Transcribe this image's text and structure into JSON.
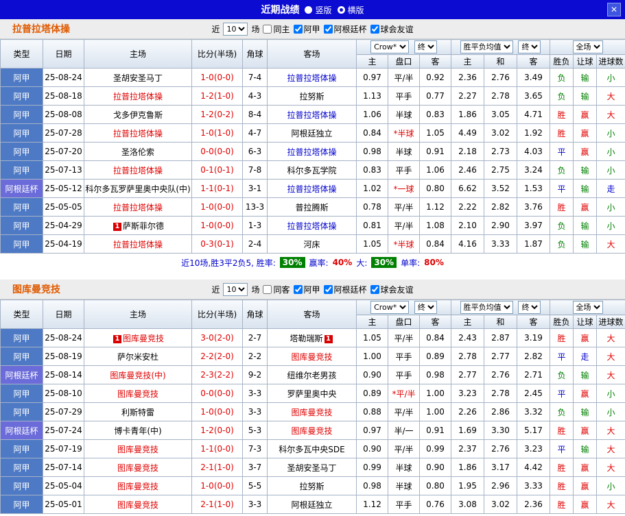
{
  "titlebar": {
    "title": "近期战绩",
    "radio_vertical": "竖版",
    "radio_horizontal": "横版",
    "selected_layout": "横版",
    "close": "✕"
  },
  "colors": {
    "titlebar_bg": "#0b0bd2",
    "section_title": "#e05a00",
    "league_bg": {
      "阿甲": "#4d79c5",
      "阿根廷杯": "#6b6bd9"
    },
    "team": {
      "red": "#e00000",
      "blue": "#0000cc",
      "black": "#000000"
    },
    "score": "#e00000",
    "handicap_star": "#e00000",
    "result_char": {
      "胜": "#e00000",
      "赢": "#e00000",
      "大": "#e00000",
      "平": "#0000cc",
      "走": "#0000cc",
      "负": "#008000",
      "输": "#008000",
      "小": "#008000"
    },
    "summary_badge": "#008000"
  },
  "table_head": {
    "type": "类型",
    "date": "日期",
    "home": "主场",
    "score": "比分(半场)",
    "corner": "角球",
    "away": "客场",
    "odds_select": "Crow*",
    "final_select": "终",
    "odds_sub": [
      "主",
      "盘口",
      "客"
    ],
    "avg_select": "胜平负均值",
    "avg_sub": [
      "主",
      "和",
      "客"
    ],
    "fulltime_select": "全场",
    "result_sub": [
      "胜负",
      "让球",
      "进球数"
    ]
  },
  "sections": [
    {
      "team": "拉普拉塔体操",
      "filters": {
        "near": "近",
        "count": "10",
        "games": "场",
        "checkboxes": [
          {
            "label": "同主",
            "checked": false
          },
          {
            "label": "阿甲",
            "checked": true
          },
          {
            "label": "阿根廷杯",
            "checked": true
          },
          {
            "label": "球会友谊",
            "checked": true
          }
        ]
      },
      "rows": [
        {
          "league": "阿甲",
          "date": "25-08-24",
          "home": "圣胡安圣马丁",
          "home_color": "black",
          "score": "1-0(0-0)",
          "corner": "7-4",
          "away": "拉普拉塔体操",
          "away_color": "blue",
          "w_home": "0.97",
          "handicap": "平/半",
          "w_away": "0.92",
          "avg_home": "2.36",
          "avg_draw": "2.76",
          "avg_away": "3.49",
          "res": [
            "负",
            "输",
            "小"
          ]
        },
        {
          "league": "阿甲",
          "date": "25-08-18",
          "home": "拉普拉塔体操",
          "home_color": "red",
          "score": "1-2(1-0)",
          "corner": "4-3",
          "away": "拉努斯",
          "away_color": "black",
          "w_home": "1.13",
          "handicap": "平手",
          "w_away": "0.77",
          "avg_home": "2.27",
          "avg_draw": "2.78",
          "avg_away": "3.65",
          "res": [
            "负",
            "输",
            "大"
          ]
        },
        {
          "league": "阿甲",
          "date": "25-08-08",
          "home": "戈多伊克鲁斯",
          "home_color": "black",
          "score": "1-2(0-2)",
          "corner": "8-4",
          "away": "拉普拉塔体操",
          "away_color": "blue",
          "w_home": "1.06",
          "handicap": "半球",
          "w_away": "0.83",
          "avg_home": "1.86",
          "avg_draw": "3.05",
          "avg_away": "4.71",
          "res": [
            "胜",
            "赢",
            "大"
          ]
        },
        {
          "league": "阿甲",
          "date": "25-07-28",
          "home": "拉普拉塔体操",
          "home_color": "red",
          "score": "1-0(1-0)",
          "corner": "4-7",
          "away": "阿根廷独立",
          "away_color": "black",
          "w_home": "0.84",
          "handicap": "*半球",
          "w_away": "1.05",
          "avg_home": "4.49",
          "avg_draw": "3.02",
          "avg_away": "1.92",
          "res": [
            "胜",
            "赢",
            "小"
          ]
        },
        {
          "league": "阿甲",
          "date": "25-07-20",
          "home": "圣洛伦索",
          "home_color": "black",
          "score": "0-0(0-0)",
          "corner": "6-3",
          "away": "拉普拉塔体操",
          "away_color": "blue",
          "w_home": "0.98",
          "handicap": "半球",
          "w_away": "0.91",
          "avg_home": "2.18",
          "avg_draw": "2.73",
          "avg_away": "4.03",
          "res": [
            "平",
            "赢",
            "小"
          ]
        },
        {
          "league": "阿甲",
          "date": "25-07-13",
          "home": "拉普拉塔体操",
          "home_color": "red",
          "score": "0-1(0-1)",
          "corner": "7-8",
          "away": "科尔多瓦学院",
          "away_color": "black",
          "w_home": "0.83",
          "handicap": "平手",
          "w_away": "1.06",
          "avg_home": "2.46",
          "avg_draw": "2.75",
          "avg_away": "3.24",
          "res": [
            "负",
            "输",
            "小"
          ]
        },
        {
          "league": "阿根廷杯",
          "date": "25-05-12",
          "home": "科尔多瓦罗萨里奥中央队(中)",
          "home_color": "black",
          "score": "1-1(0-1)",
          "corner": "3-1",
          "away": "拉普拉塔体操",
          "away_color": "blue",
          "w_home": "1.02",
          "handicap": "*一球",
          "w_away": "0.80",
          "avg_home": "6.62",
          "avg_draw": "3.52",
          "avg_away": "1.53",
          "res": [
            "平",
            "输",
            "走"
          ]
        },
        {
          "league": "阿甲",
          "date": "25-05-05",
          "home": "拉普拉塔体操",
          "home_color": "red",
          "score": "1-0(0-0)",
          "corner": "13-3",
          "away": "普拉腾斯",
          "away_color": "black",
          "w_home": "0.78",
          "handicap": "平/半",
          "w_away": "1.12",
          "avg_home": "2.22",
          "avg_draw": "2.82",
          "avg_away": "3.76",
          "res": [
            "胜",
            "赢",
            "小"
          ]
        },
        {
          "league": "阿甲",
          "date": "25-04-29",
          "home": "萨斯菲尔德",
          "home_color": "black",
          "home_badge_pre": "1",
          "score": "1-0(0-0)",
          "corner": "1-3",
          "away": "拉普拉塔体操",
          "away_color": "blue",
          "w_home": "0.81",
          "handicap": "平/半",
          "w_away": "1.08",
          "avg_home": "2.10",
          "avg_draw": "2.90",
          "avg_away": "3.97",
          "res": [
            "负",
            "输",
            "小"
          ]
        },
        {
          "league": "阿甲",
          "date": "25-04-19",
          "home": "拉普拉塔体操",
          "home_color": "red",
          "score": "0-3(0-1)",
          "corner": "2-4",
          "away": "河床",
          "away_color": "black",
          "w_home": "1.05",
          "handicap": "*半球",
          "w_away": "0.84",
          "avg_home": "4.16",
          "avg_draw": "3.33",
          "avg_away": "1.87",
          "res": [
            "负",
            "输",
            "大"
          ]
        }
      ],
      "summary": {
        "parts": [
          {
            "text": "近10场,胜3平2负5, 胜率:",
            "style": "label"
          },
          {
            "text": "30%",
            "style": "badge"
          },
          {
            "text": "赢率:",
            "style": "label"
          },
          {
            "text": "40%",
            "style": "red"
          },
          {
            "text": "大:",
            "style": "label"
          },
          {
            "text": "30%",
            "style": "badge"
          },
          {
            "text": "单率:",
            "style": "label"
          },
          {
            "text": "80%",
            "style": "red"
          }
        ]
      }
    },
    {
      "team": "图库曼竞技",
      "filters": {
        "near": "近",
        "count": "10",
        "games": "场",
        "checkboxes": [
          {
            "label": "同客",
            "checked": false
          },
          {
            "label": "阿甲",
            "checked": true
          },
          {
            "label": "阿根廷杯",
            "checked": true
          },
          {
            "label": "球会友谊",
            "checked": true
          }
        ]
      },
      "rows": [
        {
          "league": "阿甲",
          "date": "25-08-24",
          "home": "图库曼竞技",
          "home_color": "red",
          "home_badge_pre": "1",
          "score": "3-0(2-0)",
          "corner": "2-7",
          "away": "塔勒瑞斯",
          "away_color": "black",
          "away_badge_post": "1",
          "w_home": "1.05",
          "handicap": "平/半",
          "w_away": "0.84",
          "avg_home": "2.43",
          "avg_draw": "2.87",
          "avg_away": "3.19",
          "res": [
            "胜",
            "赢",
            "大"
          ]
        },
        {
          "league": "阿甲",
          "date": "25-08-19",
          "home": "萨尔米安杜",
          "home_color": "black",
          "score": "2-2(2-0)",
          "corner": "2-2",
          "away": "图库曼竞技",
          "away_color": "red",
          "w_home": "1.00",
          "handicap": "平手",
          "w_away": "0.89",
          "avg_home": "2.78",
          "avg_draw": "2.77",
          "avg_away": "2.82",
          "res": [
            "平",
            "走",
            "大"
          ]
        },
        {
          "league": "阿根廷杯",
          "date": "25-08-14",
          "home": "图库曼竞技(中)",
          "home_color": "red",
          "score": "2-3(2-2)",
          "corner": "9-2",
          "away": "纽维尔老男孩",
          "away_color": "black",
          "w_home": "0.90",
          "handicap": "平手",
          "w_away": "0.98",
          "avg_home": "2.77",
          "avg_draw": "2.76",
          "avg_away": "2.71",
          "res": [
            "负",
            "输",
            "大"
          ]
        },
        {
          "league": "阿甲",
          "date": "25-08-10",
          "home": "图库曼竞技",
          "home_color": "red",
          "score": "0-0(0-0)",
          "corner": "3-3",
          "away": "罗萨里奥中央",
          "away_color": "black",
          "w_home": "0.89",
          "handicap": "*平/半",
          "w_away": "1.00",
          "avg_home": "3.23",
          "avg_draw": "2.78",
          "avg_away": "2.45",
          "res": [
            "平",
            "赢",
            "小"
          ]
        },
        {
          "league": "阿甲",
          "date": "25-07-29",
          "home": "利斯特雷",
          "home_color": "black",
          "score": "1-0(0-0)",
          "corner": "3-3",
          "away": "图库曼竞技",
          "away_color": "red",
          "w_home": "0.88",
          "handicap": "平/半",
          "w_away": "1.00",
          "avg_home": "2.26",
          "avg_draw": "2.86",
          "avg_away": "3.32",
          "res": [
            "负",
            "输",
            "小"
          ]
        },
        {
          "league": "阿根廷杯",
          "date": "25-07-24",
          "home": "博卡青年(中)",
          "home_color": "black",
          "score": "1-2(0-0)",
          "corner": "5-3",
          "away": "图库曼竞技",
          "away_color": "red",
          "w_home": "0.97",
          "handicap": "半/一",
          "w_away": "0.91",
          "avg_home": "1.69",
          "avg_draw": "3.30",
          "avg_away": "5.17",
          "res": [
            "胜",
            "赢",
            "大"
          ]
        },
        {
          "league": "阿甲",
          "date": "25-07-19",
          "home": "图库曼竞技",
          "home_color": "red",
          "score": "1-1(0-0)",
          "corner": "7-3",
          "away": "科尔多瓦中央SDE",
          "away_color": "black",
          "w_home": "0.90",
          "handicap": "平/半",
          "w_away": "0.99",
          "avg_home": "2.37",
          "avg_draw": "2.76",
          "avg_away": "3.23",
          "res": [
            "平",
            "输",
            "大"
          ]
        },
        {
          "league": "阿甲",
          "date": "25-07-14",
          "home": "图库曼竞技",
          "home_color": "red",
          "score": "2-1(1-0)",
          "corner": "3-7",
          "away": "圣胡安圣马丁",
          "away_color": "black",
          "w_home": "0.99",
          "handicap": "半球",
          "w_away": "0.90",
          "avg_home": "1.86",
          "avg_draw": "3.17",
          "avg_away": "4.42",
          "res": [
            "胜",
            "赢",
            "大"
          ]
        },
        {
          "league": "阿甲",
          "date": "25-05-04",
          "home": "图库曼竞技",
          "home_color": "red",
          "score": "1-0(0-0)",
          "corner": "5-5",
          "away": "拉努斯",
          "away_color": "black",
          "w_home": "0.98",
          "handicap": "半球",
          "w_away": "0.80",
          "avg_home": "1.95",
          "avg_draw": "2.96",
          "avg_away": "3.33",
          "res": [
            "胜",
            "赢",
            "小"
          ]
        },
        {
          "league": "阿甲",
          "date": "25-05-01",
          "home": "图库曼竞技",
          "home_color": "red",
          "score": "2-1(1-0)",
          "corner": "3-3",
          "away": "阿根廷独立",
          "away_color": "black",
          "w_home": "1.12",
          "handicap": "平手",
          "w_away": "0.76",
          "avg_home": "3.08",
          "avg_draw": "3.02",
          "avg_away": "2.36",
          "res": [
            "胜",
            "赢",
            "大"
          ]
        }
      ]
    }
  ]
}
